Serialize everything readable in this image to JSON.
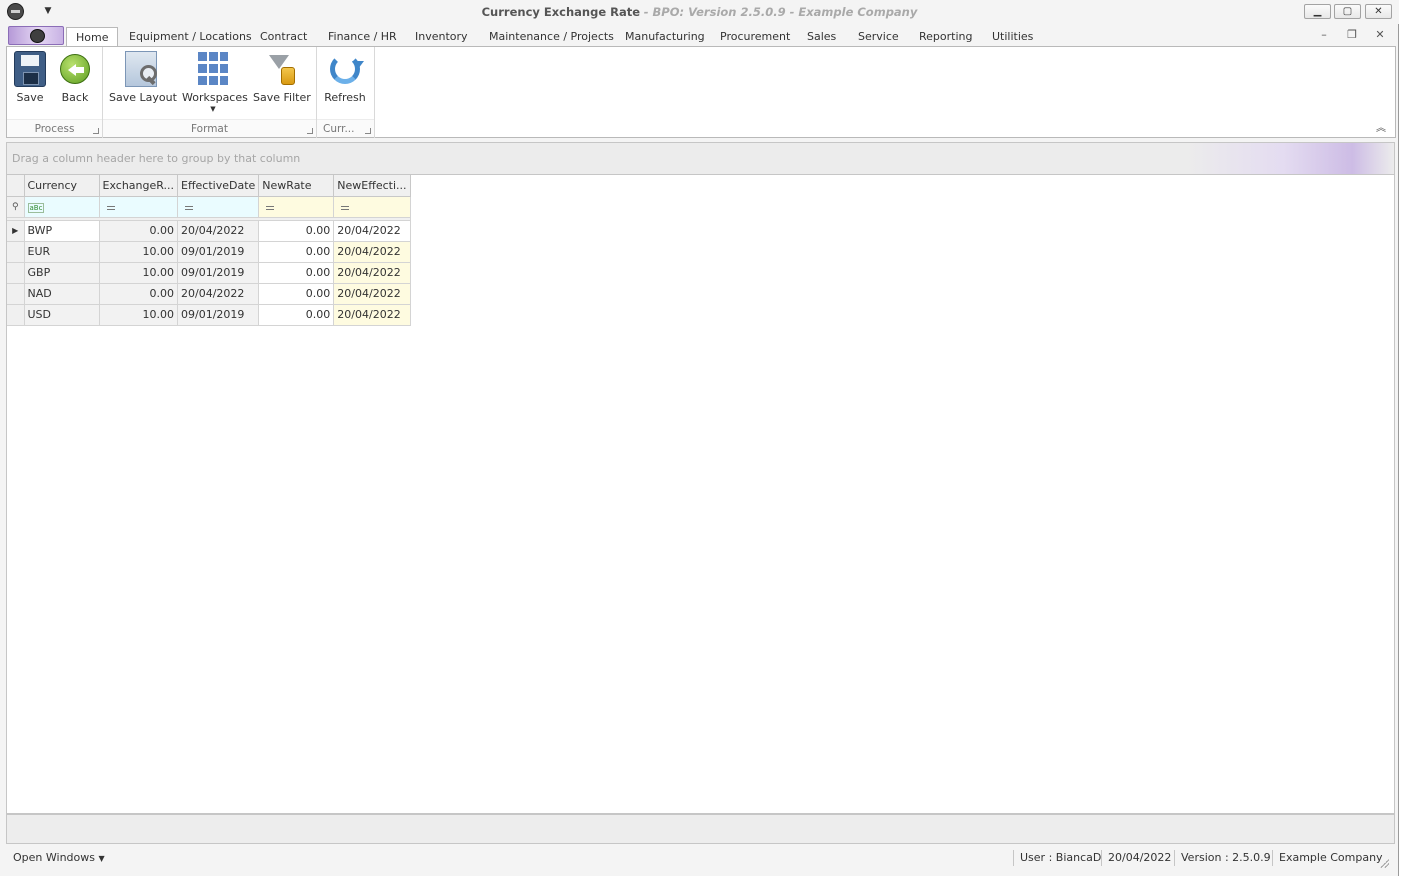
{
  "title_bar": {
    "title": "Currency Exchange Rate",
    "subtitle": "- BPO: Version 2.5.0.9 - Example Company",
    "minimize_icon": "minimize-icon",
    "maximize_icon": "maximize-icon",
    "close_icon": "close-icon"
  },
  "ribbon_tabs": [
    {
      "label": "Home",
      "active": true
    },
    {
      "label": "Equipment / Locations"
    },
    {
      "label": "Contract"
    },
    {
      "label": "Finance / HR"
    },
    {
      "label": "Inventory"
    },
    {
      "label": "Maintenance / Projects"
    },
    {
      "label": "Manufacturing"
    },
    {
      "label": "Procurement"
    },
    {
      "label": "Sales"
    },
    {
      "label": "Service"
    },
    {
      "label": "Reporting"
    },
    {
      "label": "Utilities"
    }
  ],
  "ribbon_groups": {
    "process": {
      "caption": "Process",
      "buttons": [
        {
          "label": "Save",
          "icon": "floppy-disk-icon"
        },
        {
          "label": "Back",
          "icon": "back-arrow-icon"
        }
      ]
    },
    "format": {
      "caption": "Format",
      "buttons": [
        {
          "label": "Save Layout",
          "icon": "save-layout-icon"
        },
        {
          "label": "Workspaces",
          "icon": "workspaces-grid-icon"
        },
        {
          "label": "Save Filter",
          "icon": "save-filter-icon"
        }
      ]
    },
    "current": {
      "caption": "Curr...",
      "buttons": [
        {
          "label": "Refresh",
          "icon": "refresh-icon"
        }
      ]
    }
  },
  "grid": {
    "group_panel_text": "Drag a column header here to group by that column",
    "columns": [
      "Currency",
      "ExchangeR...",
      "EffectiveDate",
      "NewRate",
      "NewEffecti..."
    ],
    "rows": [
      {
        "currency": "BWP",
        "exchange_rate": "0.00",
        "effective_date": "20/04/2022",
        "new_rate": "0.00",
        "new_effective_date": "20/04/2022"
      },
      {
        "currency": "EUR",
        "exchange_rate": "10.00",
        "effective_date": "09/01/2019",
        "new_rate": "0.00",
        "new_effective_date": "20/04/2022"
      },
      {
        "currency": "GBP",
        "exchange_rate": "10.00",
        "effective_date": "09/01/2019",
        "new_rate": "0.00",
        "new_effective_date": "20/04/2022"
      },
      {
        "currency": "NAD",
        "exchange_rate": "0.00",
        "effective_date": "20/04/2022",
        "new_rate": "0.00",
        "new_effective_date": "20/04/2022"
      },
      {
        "currency": "USD",
        "exchange_rate": "10.00",
        "effective_date": "09/01/2019",
        "new_rate": "0.00",
        "new_effective_date": "20/04/2022"
      }
    ]
  },
  "status_bar": {
    "open_windows": "Open Windows",
    "user": "User : BiancaD",
    "date": "20/04/2022",
    "version": "Version : 2.5.0.9",
    "company": "Example Company"
  }
}
